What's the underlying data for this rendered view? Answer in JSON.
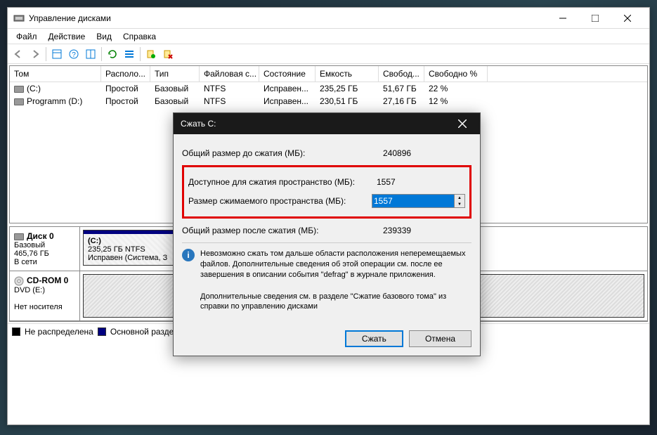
{
  "window": {
    "title": "Управление дисками"
  },
  "menu": {
    "file": "Файл",
    "action": "Действие",
    "view": "Вид",
    "help": "Справка"
  },
  "table": {
    "headers": {
      "tom": "Том",
      "loc": "Располо...",
      "type": "Тип",
      "fs": "Файловая с...",
      "state": "Состояние",
      "cap": "Емкость",
      "free": "Свобод...",
      "freepc": "Свободно %"
    },
    "rows": [
      {
        "tom": "(C:)",
        "loc": "Простой",
        "type": "Базовый",
        "fs": "NTFS",
        "state": "Исправен...",
        "cap": "235,25 ГБ",
        "free": "51,67 ГБ",
        "freepc": "22 %"
      },
      {
        "tom": "Programm (D:)",
        "loc": "Простой",
        "type": "Базовый",
        "fs": "NTFS",
        "state": "Исправен...",
        "cap": "230,51 ГБ",
        "free": "27,16 ГБ",
        "freepc": "12 %"
      }
    ]
  },
  "disks": {
    "d0": {
      "name": "Диск 0",
      "type": "Базовый",
      "size": "465,76 ГБ",
      "status": "В сети",
      "part_name": "(C:)",
      "part_info": "235,25 ГБ NTFS",
      "part_state": "Исправен (Система, З"
    },
    "cd": {
      "name": "CD-ROM 0",
      "type": "DVD (E:)",
      "status": "Нет носителя"
    }
  },
  "legend": {
    "unalloc": "Не распределена",
    "primary": "Основной раздел"
  },
  "dialog": {
    "title": "Сжать C:",
    "total_before_label": "Общий размер до сжатия (МБ):",
    "total_before": "240896",
    "available_label": "Доступное для сжатия пространство (МБ):",
    "available": "1557",
    "shrink_label": "Размер сжимаемого пространства (МБ):",
    "shrink_value": "1557",
    "total_after_label": "Общий размер после сжатия (МБ):",
    "total_after": "239339",
    "info1": "Невозможно сжать том дальше области расположения неперемещаемых файлов. Дополнительные сведения об этой операции см. после ее завершения в описании события \"defrag\" в журнале приложения.",
    "info2": "Дополнительные сведения см. в разделе \"Сжатие базового тома\" из справки по управлению дисками",
    "btn_shrink": "Сжать",
    "btn_cancel": "Отмена"
  }
}
